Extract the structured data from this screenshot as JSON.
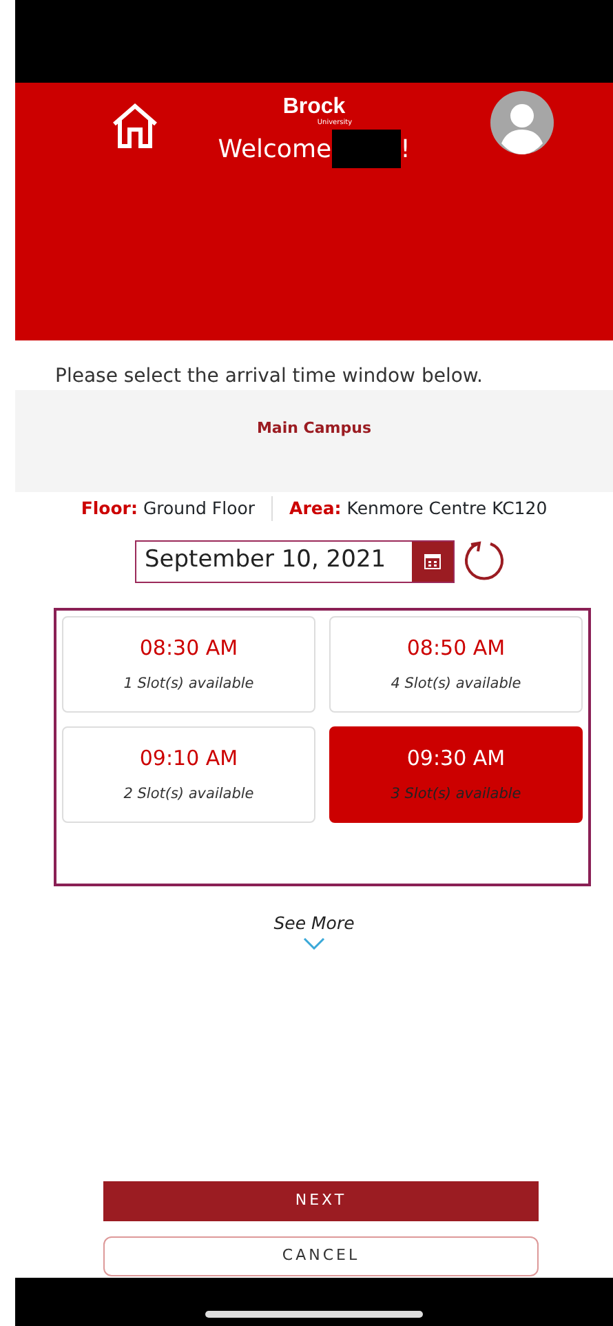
{
  "header": {
    "logo": {
      "title": "Brock",
      "subtitle": "University"
    },
    "welcome": "Welcome",
    "welcome_end": "!"
  },
  "instruction": "Please select the arrival time window below.",
  "campus": "Main Campus",
  "location": [
    {
      "label": "Floor:",
      "value": "Ground Floor"
    },
    {
      "label": "Area:",
      "value": "Kenmore Centre KC120"
    }
  ],
  "date": {
    "value": "September 10, 2021"
  },
  "slots": [
    {
      "time": "08:30 AM",
      "availability": "1 Slot(s) available",
      "selected": false
    },
    {
      "time": "08:50 AM",
      "availability": "4 Slot(s) available",
      "selected": false
    },
    {
      "time": "09:10 AM",
      "availability": "2 Slot(s) available",
      "selected": false
    },
    {
      "time": "09:30 AM",
      "availability": "3 Slot(s) available",
      "selected": true
    }
  ],
  "see_more": "See More",
  "buttons": [
    {
      "kind": "primary",
      "label": "NEXT"
    },
    {
      "kind": "outline",
      "label": "CANCEL"
    }
  ]
}
